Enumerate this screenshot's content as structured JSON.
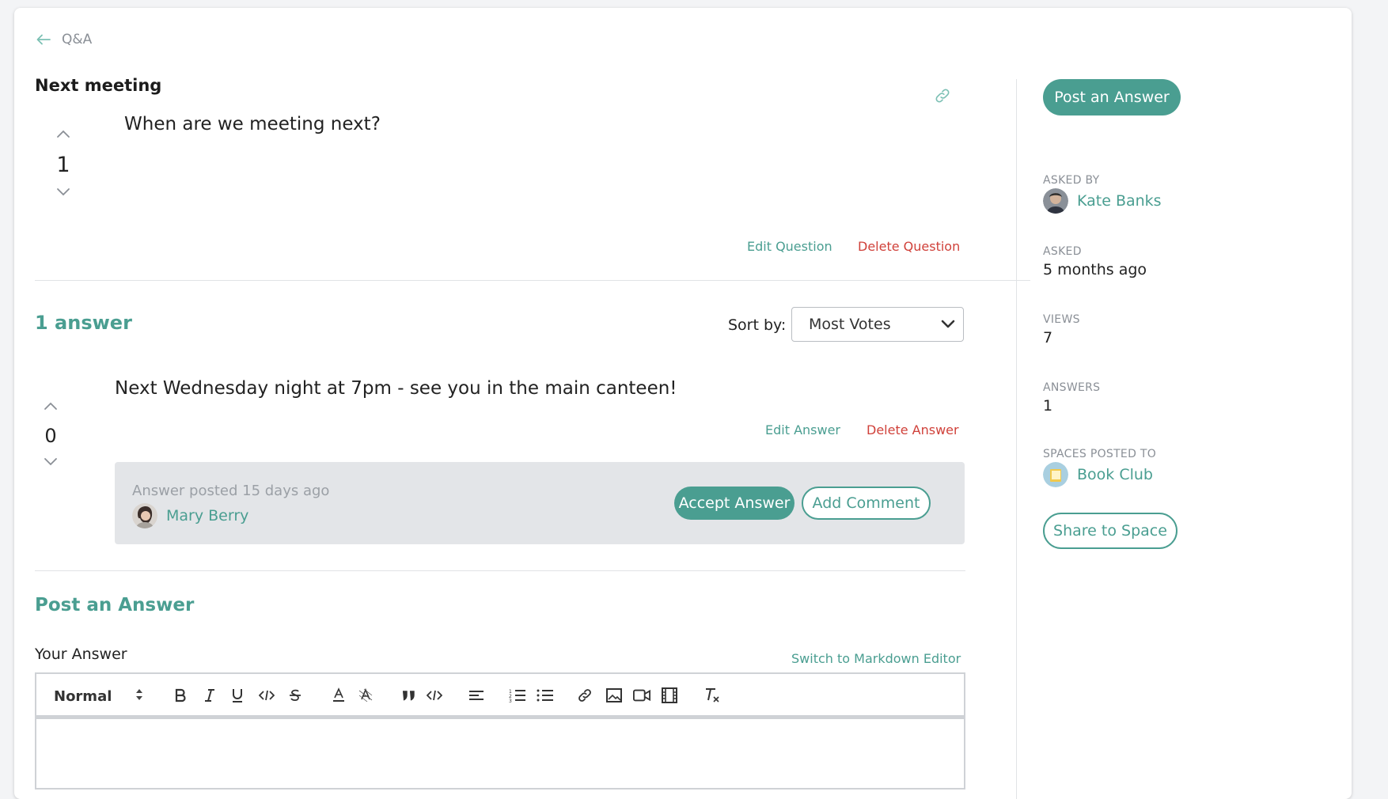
{
  "nav": {
    "back_label": "Q&A"
  },
  "question": {
    "title": "Next meeting",
    "body": "When are we meeting next?",
    "votes": "1",
    "edit_label": "Edit Question",
    "delete_label": "Delete Question"
  },
  "answers_section": {
    "count_label": "1 answer",
    "sort_label": "Sort by:",
    "sort_value": "Most Votes"
  },
  "answer": {
    "body": "Next Wednesday night at 7pm - see you in the main canteen!",
    "votes": "0",
    "edit_label": "Edit Answer",
    "delete_label": "Delete Answer",
    "posted_text": "Answer posted 15 days ago",
    "author": "Mary Berry",
    "accept_label": "Accept Answer",
    "comment_label": "Add Comment"
  },
  "post_answer": {
    "title": "Post an Answer",
    "field_label": "Your Answer",
    "switch_label": "Switch to Markdown Editor",
    "format_value": "Normal"
  },
  "sidebar": {
    "post_button": "Post an Answer",
    "asked_by_label": "ASKED BY",
    "asked_by": "Kate Banks",
    "asked_label": "ASKED",
    "asked_value": "5 months ago",
    "views_label": "VIEWS",
    "views_value": "7",
    "answers_label": "ANSWERS",
    "answers_value": "1",
    "spaces_label": "SPACES POSTED TO",
    "space_name": "Book Club",
    "share_button": "Share to Space"
  },
  "colors": {
    "accent": "#4a9e91",
    "danger": "#d0413a",
    "panel": "#e3e5e8"
  }
}
